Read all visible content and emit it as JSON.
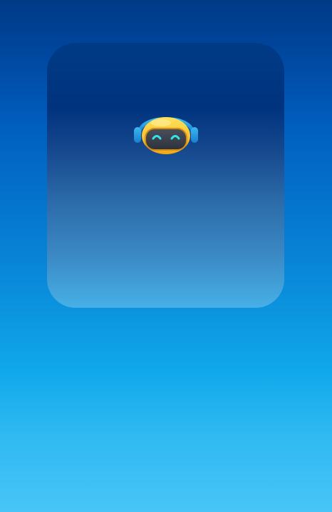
{
  "screen": {
    "background_top": "#003a86",
    "background_bottom": "#48c5f6"
  },
  "card": {
    "icon": "robot-mascot-icon",
    "colors": {
      "helmet": "#f7c51e",
      "visor": "#3a3f4b",
      "eyes": "#2ee6e6",
      "headphones": "#29a3e3"
    }
  }
}
